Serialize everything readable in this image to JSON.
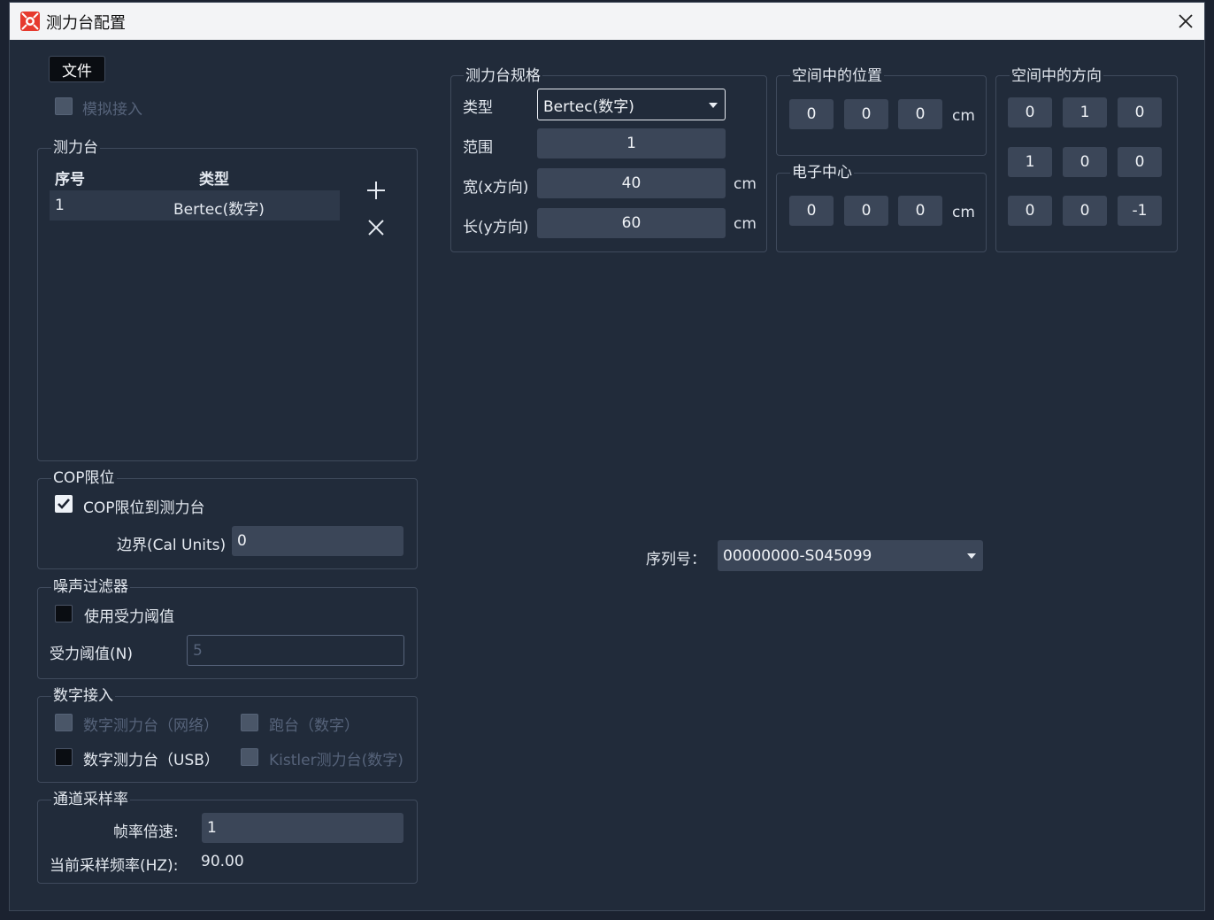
{
  "window": {
    "title": "测力台配置",
    "close_glyph": "✕"
  },
  "file_button": "文件",
  "simulate": {
    "label": "模拟接入",
    "checked": false
  },
  "force_plates": {
    "legend": "测力台",
    "col_index": "序号",
    "col_type": "类型",
    "rows": [
      {
        "index": "1",
        "type": "Bertec(数字)"
      }
    ],
    "add_glyph": "+",
    "remove_glyph": "✕"
  },
  "cop": {
    "legend": "COP限位",
    "checkbox_label": "COP限位到测力台",
    "checked": true,
    "boundary_label": "边界(Cal Units)",
    "boundary_value": "0"
  },
  "noise": {
    "legend": "噪声过滤器",
    "checkbox_label": "使用受力阈值",
    "checked": false,
    "threshold_label": "受力阈值(N)",
    "threshold_placeholder": "5"
  },
  "digital": {
    "legend": "数字接入",
    "opt_network": "数字测力台（网络）",
    "opt_treadmill": "跑台（数字）",
    "opt_usb": "数字测力台（USB）",
    "opt_kistler": "Kistler测力台(数字)"
  },
  "sampling": {
    "legend": "通道采样率",
    "multiplier_label": "帧率倍速:",
    "multiplier_value": "1",
    "current_label": "当前采样频率(HZ):",
    "current_value": "90.00"
  },
  "spec": {
    "legend": "测力台规格",
    "type_label": "类型",
    "type_value": "Bertec(数字)",
    "range_label": "范围",
    "range_value": "1",
    "width_label": "宽(x方向)",
    "width_value": "40",
    "length_label": "长(y方向)",
    "length_value": "60",
    "unit": "cm"
  },
  "position": {
    "legend": "空间中的位置",
    "values": [
      "0",
      "0",
      "0"
    ],
    "unit": "cm"
  },
  "electronic_center": {
    "legend": "电子中心",
    "values": [
      "0",
      "0",
      "0"
    ],
    "unit": "cm"
  },
  "orientation": {
    "legend": "空间中的方向",
    "matrix": [
      [
        "0",
        "1",
        "0"
      ],
      [
        "1",
        "0",
        "0"
      ],
      [
        "0",
        "0",
        "-1"
      ]
    ]
  },
  "serial": {
    "label": "序列号：",
    "value": "00000000-S045099"
  },
  "colors": {
    "bg": "#212b3a",
    "field": "#3b4658",
    "border": "#3f4a5c",
    "accent": "#e63a2e"
  }
}
